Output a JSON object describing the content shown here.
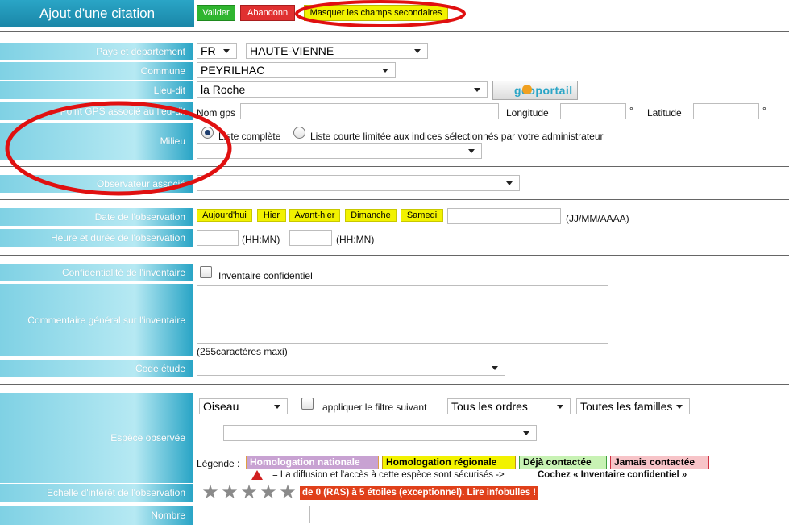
{
  "header": {
    "title": "Ajout d'une citation",
    "validate_label": "Valider",
    "abandon_label": "Abandonn",
    "toggle_secondary_label": "Masquer les champs secondaires"
  },
  "labels": {
    "pays": "Pays et département",
    "commune": "Commune",
    "lieu_dit": "Lieu-dit",
    "gps": "Point GPS associé au lieu-dit",
    "milieu": "Milieu",
    "observateur": "Observateur associé",
    "date": "Date de l'observation",
    "heure": "Heure et durée de l'observation",
    "confidentialite": "Confidentialité de l'inventaire",
    "commentaire": "Commentaire général sur l'inventaire",
    "code_etude": "Code étude",
    "espece": "Espèce observée",
    "echelle": "Echelle d'intérêt de l'observation",
    "nombre": "Nombre"
  },
  "fields": {
    "country_value": "FR",
    "department_value": "HAUTE-VIENNE",
    "commune_value": "PEYRILHAC",
    "lieu_dit_value": "la Roche",
    "geoportail_label": "géoportail",
    "nom_gps_label": "Nom gps",
    "longitude_label": "Longitude",
    "latitude_label": "Latitude",
    "degree_symbol": "°",
    "milieu_radio_full": "Liste complète",
    "milieu_radio_short": "Liste courte limitée aux indices sélectionnés par votre administrateur",
    "date_buttons": [
      "Aujourd'hui",
      "Hier",
      "Avant-hier",
      "Dimanche",
      "Samedi"
    ],
    "date_format": "(JJ/MM/AAAA)",
    "time_format_1": "(HH:MN)",
    "time_format_2": "(HH:MN)",
    "confidential_label": "Inventaire confidentiel",
    "comment_max": "(255caractères maxi)",
    "espece_group": "Oiseau",
    "filter_label": "appliquer le filtre suivant",
    "ordres_value": "Tous les ordres",
    "familles_value": "Toutes les familles",
    "legend_label": "Légende :",
    "legend_tags": [
      "Homologation nationale",
      "Homologation régionale",
      "Déjà contactée",
      "Jamais contactée"
    ],
    "warning_text": "= La diffusion et l'accès à cette espèce sont sécurisés ->",
    "warning_bold": "Cochez « Inventaire confidentiel »",
    "scale_text": "de 0 (RAS) à 5 étoiles (exceptionnel). Lire infobulles !"
  },
  "colors": {
    "header_bg": "#1f95b7",
    "validate": "#2fb52f",
    "abandon": "#e03030",
    "yellow": "#f2f200",
    "annotation_red": "#e01010",
    "legend_national": "#c8a2d2",
    "legend_regional": "#f2f200",
    "legend_deja": "#c8f2b4",
    "legend_jamais": "#f7c4c8",
    "scale_bg": "#e0401a"
  },
  "stars": {
    "count": 5,
    "value": 0
  }
}
